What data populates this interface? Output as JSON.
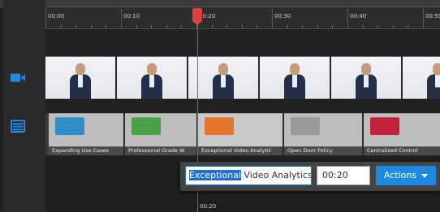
{
  "ruler": {
    "ticks": [
      "00:00",
      "00:10",
      "00:20",
      "00:30",
      "00:40",
      "00:50"
    ]
  },
  "colors": {
    "accent": "#1e88e5",
    "playhead": "#e04040",
    "track_icon": "#1e88e5"
  },
  "icons": {
    "video_track": "video-camera-icon",
    "slide_track": "slides-list-icon"
  },
  "slides": [
    {
      "label": "Expanding Use Cases"
    },
    {
      "label": "Professional Grade W"
    },
    {
      "label": "Exceptional Video Analytic"
    },
    {
      "label": "Open Door Policy"
    },
    {
      "label": "Centralized Control"
    }
  ],
  "editor": {
    "title_selected": "Exceptional",
    "title_rest": " Video Analytics",
    "time_value": "00:20",
    "actions_label": "Actions"
  },
  "playhead": {
    "time": "00:20"
  }
}
